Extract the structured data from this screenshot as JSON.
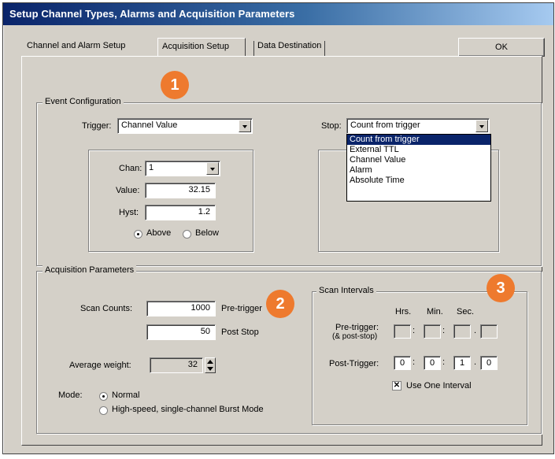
{
  "window": {
    "title": "Setup Channel Types, Alarms and Acquisition Parameters",
    "ok_label": "OK"
  },
  "tabs": [
    {
      "label": "Channel and Alarm Setup"
    },
    {
      "label": "Acquisition Setup"
    },
    {
      "label": "Data Destination"
    }
  ],
  "event": {
    "group_label": "Event Configuration",
    "trigger_label": "Trigger:",
    "trigger_value": "Channel Value",
    "stop_label": "Stop:",
    "stop_value": "Count from trigger",
    "stop_options": [
      "Count from trigger",
      "External TTL",
      "Channel Value",
      "Alarm",
      "Absolute Time"
    ],
    "chan_label": "Chan:",
    "chan_value": "1",
    "value_label": "Value:",
    "value_value": "32.15",
    "hyst_label": "Hyst:",
    "hyst_value": "1.2",
    "above_label": "Above",
    "below_label": "Below"
  },
  "acq": {
    "group_label": "Acquisition Parameters",
    "scan_counts_label": "Scan Counts:",
    "pretrigger_count": "1000",
    "pretrigger_label": "Pre-trigger",
    "poststop_count": "50",
    "poststop_label": "Post Stop",
    "avg_label": "Average weight:",
    "avg_value": "32",
    "mode_label": "Mode:",
    "mode_normal": "Normal",
    "mode_burst": "High-speed, single-channel Burst Mode"
  },
  "scan": {
    "group_label": "Scan Intervals",
    "hrs": "Hrs.",
    "min": "Min.",
    "sec": "Sec.",
    "pretrigger_label_1": "Pre-trigger:",
    "pretrigger_label_2": "(& post-stop)",
    "posttrigger_label": "Post-Trigger:",
    "post_hrs": "0",
    "post_min": "0",
    "post_sec": "1",
    "post_frac": "0",
    "use_one_label": "Use One Interval"
  },
  "badges": [
    "1",
    "2",
    "3"
  ],
  "colors": {
    "badge": "#ee7a2e",
    "title_start": "#0a246a",
    "title_end": "#a6caf0",
    "face": "#d4d0c8"
  }
}
